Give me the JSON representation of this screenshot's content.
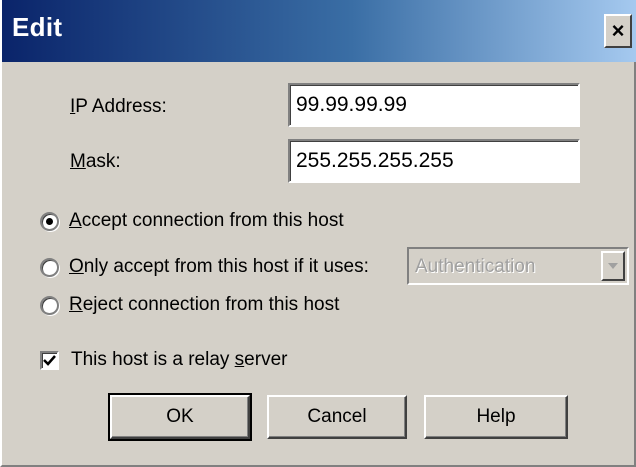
{
  "window": {
    "title": "Edit",
    "close_label": "×"
  },
  "fields": {
    "ip_label": "IP Address:",
    "ip_value": "99.99.99.99",
    "mask_label": "Mask:",
    "mask_value": "255.255.255.255"
  },
  "options": {
    "accept_label": "Accept connection from this host",
    "only_accept_label": "Only accept from this host if it uses:",
    "reject_label": "Reject connection from this host",
    "selected": "accept",
    "auth_combo_value": "Authentication"
  },
  "relay": {
    "label_prefix": "This host is a relay ",
    "label_underlined": "s",
    "label_suffix": "erver",
    "checked": true
  },
  "buttons": {
    "ok": "OK",
    "cancel": "Cancel",
    "help": "Help"
  },
  "colors": {
    "title_gradient_start": "#0a246a",
    "title_gradient_end": "#a6caf0",
    "dialog_face": "#d4d0c8"
  }
}
